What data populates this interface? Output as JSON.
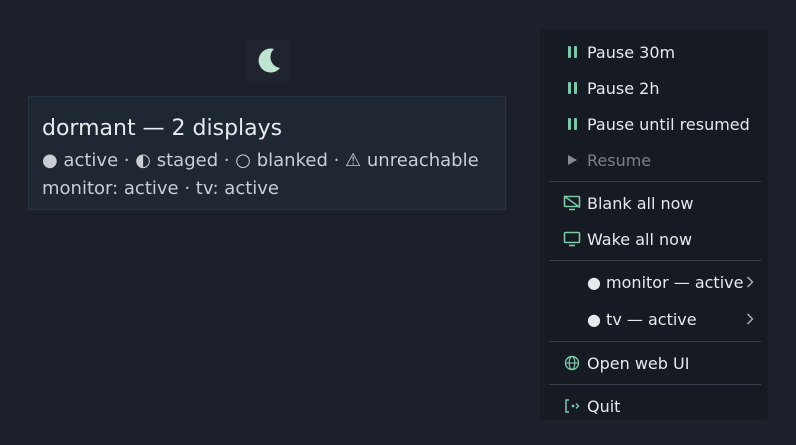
{
  "tooltip": {
    "title": "dormant — 2 displays",
    "legend": "● active · ◐ staged · ○ blanked · ⚠ unreachable",
    "status": "monitor: active · tv: active"
  },
  "menu": {
    "pause_30m": "Pause 30m",
    "pause_2h": "Pause 2h",
    "pause_until_resumed": "Pause until resumed",
    "resume": "Resume",
    "blank_all": "Blank all now",
    "wake_all": "Wake all now",
    "monitor": "● monitor — active",
    "tv": "● tv — active",
    "open_web_ui": "Open web UI",
    "quit": "Quit"
  },
  "icons": {
    "tray": "moon-icon",
    "pause": "pause-icon",
    "resume": "play-icon",
    "blank": "monitor-off-icon",
    "wake": "monitor-icon",
    "submenu": "chevron-right-icon",
    "web": "globe-icon",
    "quit": "exit-icon"
  },
  "colors": {
    "background": "#1b202b",
    "menu_background": "#161a22",
    "accent": "#7ec7a9",
    "moon": "#bfe4d2"
  }
}
